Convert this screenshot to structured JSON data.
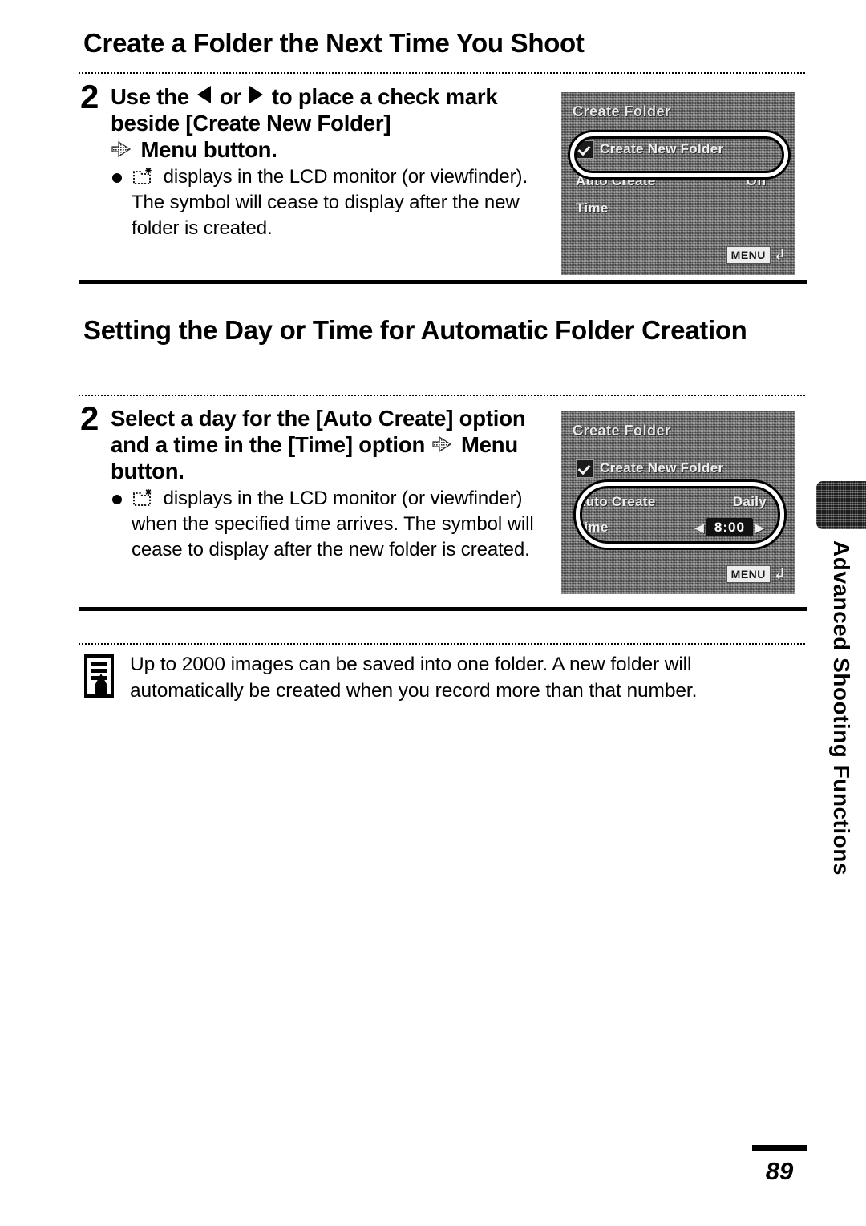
{
  "page": {
    "number": "89",
    "side_tab_label": "Advanced Shooting Functions"
  },
  "sections": [
    {
      "heading": "Create a Folder the Next Time You Shoot",
      "step": {
        "number": "2",
        "title_part_1": "Use the",
        "title_part_2": "or",
        "title_part_3": "to place a check mark beside [Create New Folder]",
        "title_part_4": "Menu button.",
        "note_part_1": "displays in the LCD monitor (or viewfinder). The symbol will cease to display after the new folder is created."
      },
      "lcd": {
        "title": "Create Folder",
        "rows": [
          {
            "label": "Create New Folder",
            "checked": "true",
            "value": ""
          },
          {
            "label": "Auto Create",
            "checked": "false",
            "value": "Off"
          },
          {
            "label": "Time",
            "checked": "false",
            "value": ""
          }
        ],
        "menu_badge": "MENU",
        "menu_return_glyph": "↲"
      }
    },
    {
      "heading": "Setting the Day or Time for Automatic Folder Creation",
      "step": {
        "number": "2",
        "title_part_1": "Select a day for the [Auto Create] option and a time in the [Time] option",
        "title_part_4": "Menu button.",
        "note_part_1": "displays in the LCD monitor (or viewfinder) when the specified time arrives. The symbol will cease to display after the new folder is created."
      },
      "lcd": {
        "title": "Create Folder",
        "rows": [
          {
            "label": "Create New Folder",
            "checked": "true",
            "value": ""
          },
          {
            "label": "Auto Create",
            "checked": "false",
            "value": "Daily"
          },
          {
            "label": "Time",
            "checked": "false",
            "value": "8:00"
          }
        ],
        "menu_badge": "MENU",
        "menu_return_glyph": "↲"
      }
    }
  ],
  "note": {
    "text": "Up to 2000 images can be saved into one folder. A new folder will automatically be created when you record more than that number."
  },
  "icons": {
    "arrow_right": "menu-arrow-icon",
    "folder_star": "new-folder-star-icon",
    "note": "note-pencil-icon",
    "tri_left": "left-arrow-icon",
    "tri_right": "right-arrow-icon"
  }
}
